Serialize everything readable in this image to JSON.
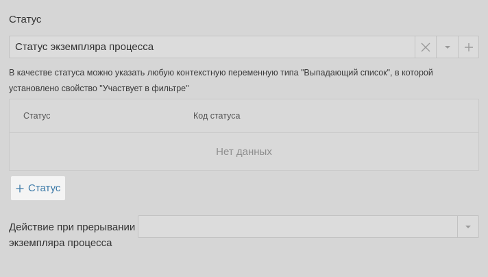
{
  "status_section": {
    "label": "Статус",
    "select_value": "Статус экземпляра процесса",
    "hint": "В качестве статуса можно указать любую контекстную переменную типа \"Выпадающий список\", в которой установлено свойство \"Участвует в фильтре\""
  },
  "status_table": {
    "columns": [
      "Статус",
      "Код статуса"
    ],
    "empty_text": "Нет данных"
  },
  "add_status_label": "Статус",
  "interrupt_action": {
    "label": "Действие при прерывании экземпляра процесса",
    "select_value": ""
  },
  "icons": [
    "clear-icon",
    "chevron-down-icon",
    "plus-icon"
  ]
}
